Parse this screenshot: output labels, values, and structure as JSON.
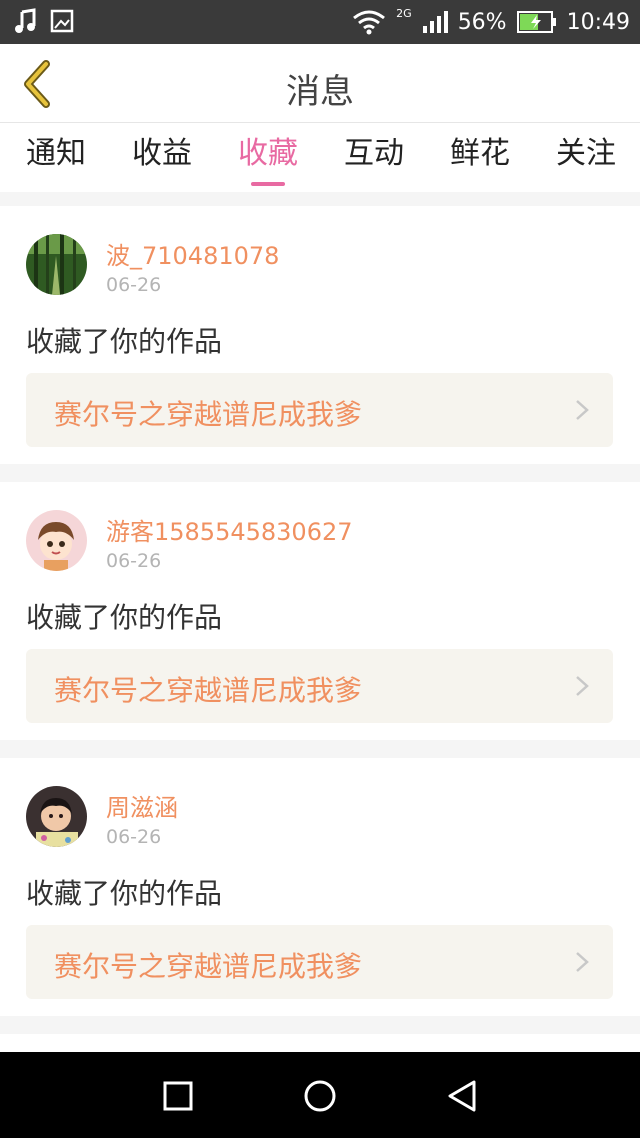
{
  "status": {
    "network": "2G",
    "battery": "56%",
    "time": "10:49"
  },
  "header": {
    "title": "消息"
  },
  "tabs": [
    {
      "label": "通知"
    },
    {
      "label": "收益"
    },
    {
      "label": "收藏",
      "active": true
    },
    {
      "label": "互动"
    },
    {
      "label": "鲜花"
    },
    {
      "label": "关注"
    }
  ],
  "messages": [
    {
      "user": "波_710481078",
      "date": "06-26",
      "action": "收藏了你的作品",
      "work": "赛尔号之穿越谱尼成我爹"
    },
    {
      "user": "游客1585545830627",
      "date": "06-26",
      "action": "收藏了你的作品",
      "work": "赛尔号之穿越谱尼成我爹"
    },
    {
      "user": "周滋涵",
      "date": "06-26",
      "action": "收藏了你的作品",
      "work": "赛尔号之穿越谱尼成我爹"
    }
  ],
  "colors": {
    "accent": "#e86aa2",
    "username": "#f09060",
    "back_arrow": "#e7c33c"
  }
}
